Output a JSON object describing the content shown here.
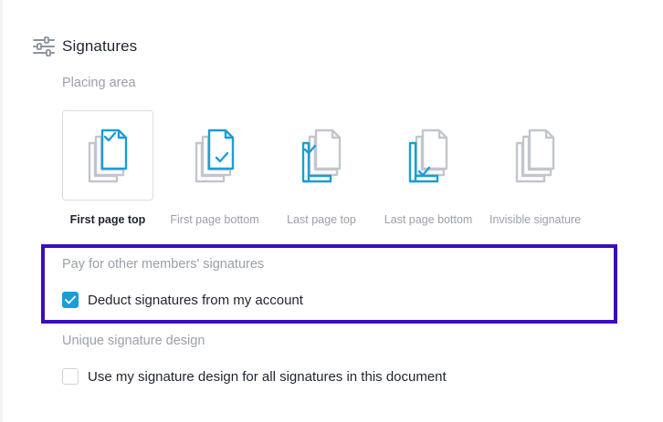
{
  "section": {
    "title": "Signatures",
    "icon": "sliders-icon"
  },
  "placing_area": {
    "heading": "Placing area",
    "options": [
      {
        "label": "First page top",
        "selected": true,
        "icon": "doc-first-top-icon"
      },
      {
        "label": "First page bottom",
        "selected": false,
        "icon": "doc-first-bottom-icon"
      },
      {
        "label": "Last page top",
        "selected": false,
        "icon": "doc-last-top-icon"
      },
      {
        "label": "Last page bottom",
        "selected": false,
        "icon": "doc-last-bottom-icon"
      },
      {
        "label": "Invisible signature",
        "selected": false,
        "icon": "doc-invisible-icon"
      }
    ]
  },
  "pay_section": {
    "heading": "Pay for other members' signatures",
    "checkbox_label": "Deduct signatures from my account",
    "checked": true
  },
  "design_section": {
    "heading": "Unique signature design",
    "checkbox_label": "Use my signature design for all signatures in this document",
    "checked": false
  },
  "colors": {
    "accent": "#1A9ED6",
    "highlight": "#3A0FB8",
    "muted_text": "#9AA0A9",
    "text": "#1F2430"
  }
}
